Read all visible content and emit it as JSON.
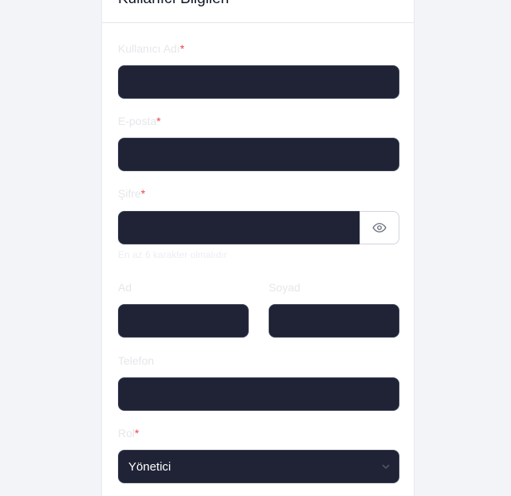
{
  "card": {
    "title": "Kullanıcı Bilgileri"
  },
  "form": {
    "username": {
      "label": "Kullanıcı Adı",
      "required_mark": "*",
      "value": ""
    },
    "email": {
      "label": "E-posta",
      "required_mark": "*",
      "value": ""
    },
    "password": {
      "label": "Şifre",
      "required_mark": "*",
      "value": "",
      "help": "En az 6 karakter olmalıdır",
      "toggle_icon": "eye-icon"
    },
    "first_name": {
      "label": "Ad",
      "value": ""
    },
    "last_name": {
      "label": "Soyad",
      "value": ""
    },
    "phone": {
      "label": "Telefon",
      "value": ""
    },
    "role": {
      "label": "Rol",
      "required_mark": "*",
      "selected": "Yönetici",
      "icon": "chevron-down-icon"
    }
  },
  "colors": {
    "page_background": "#f3f4f8",
    "card_background": "#ffffff",
    "input_background": "#1f2335",
    "required": "#ef4444"
  }
}
